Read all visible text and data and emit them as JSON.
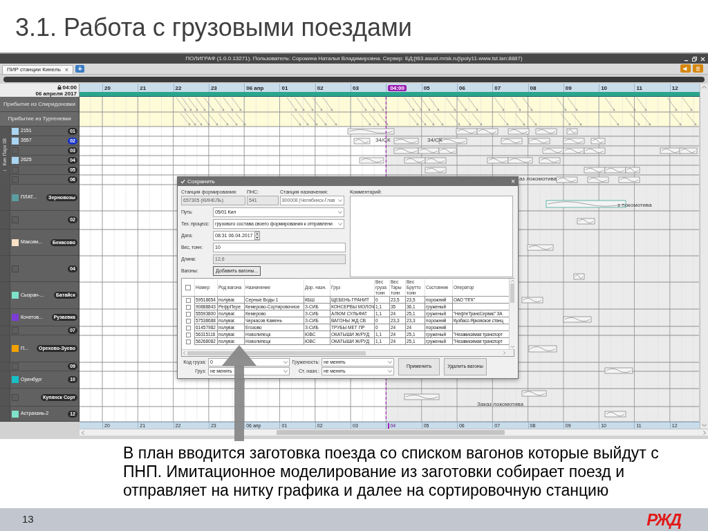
{
  "slide": {
    "title": "3.1. Работа с грузовыми поездами",
    "description": "В план вводится заготовка поезда со списком вагонов которые выйдут с ПНП. Имитационное моделирование из заготовки собирает поезд и отправляет на нитку графика и далее на сортировочную станцию",
    "page_number": "13",
    "logo": "РЖД"
  },
  "app": {
    "window": {
      "title": "ПОЛИГРАФ (1.0.0.13271). Пользователь: Сорокина Наталья Владимировна. Сервер: БД:[t63.asust.mrsk.ru]\\poly11-www.tst.lan:8887)"
    },
    "tabs": [
      {
        "label": "ПИР станции Кинель",
        "close": "×",
        "selected": true
      }
    ],
    "add_tab": "+",
    "timeline": {
      "current_time": "04:00",
      "date": "06 апреля 2017",
      "hours": [
        {
          "label": "20",
          "current": false
        },
        {
          "label": "21",
          "current": false
        },
        {
          "label": "22",
          "current": false
        },
        {
          "label": "23",
          "current": false
        },
        {
          "label": "06 апр",
          "current": false
        },
        {
          "label": "01",
          "current": false
        },
        {
          "label": "02",
          "current": false
        },
        {
          "label": "03",
          "current": false
        },
        {
          "label": "04:00",
          "current": true
        },
        {
          "label": "05",
          "current": false
        },
        {
          "label": "06",
          "current": false
        },
        {
          "label": "07",
          "current": false
        },
        {
          "label": "08",
          "current": false
        },
        {
          "label": "09",
          "current": false
        },
        {
          "label": "10",
          "current": false
        },
        {
          "label": "11",
          "current": false
        },
        {
          "label": "12",
          "current": false
        }
      ],
      "bottom_hours": [
        {
          "label": "20",
          "current": false
        },
        {
          "label": "21",
          "current": false
        },
        {
          "label": "22",
          "current": false
        },
        {
          "label": "23",
          "current": false
        },
        {
          "label": "06 апр",
          "current": false
        },
        {
          "label": "01",
          "current": false
        },
        {
          "label": "02",
          "current": false
        },
        {
          "label": "03",
          "current": false
        },
        {
          "label": "04",
          "current": true
        },
        {
          "label": "05",
          "current": false
        },
        {
          "label": "06",
          "current": false
        },
        {
          "label": "07",
          "current": false
        },
        {
          "label": "08",
          "current": false
        },
        {
          "label": "09",
          "current": false
        },
        {
          "label": "10",
          "current": false
        },
        {
          "label": "11",
          "current": false
        },
        {
          "label": "12",
          "current": false
        }
      ]
    },
    "sidebar": {
      "arrivals": [
        {
          "label": "Прибытие из Спиридоновки"
        },
        {
          "label": "Прибытие из Тургеневки"
        }
      ],
      "park": {
        "toggle": "–",
        "label": "Кин Парк 08",
        "tracks": [
          {
            "name": "2151",
            "badge": "01",
            "color": "#a9d4f2",
            "selected": false
          },
          {
            "name": "3557",
            "badge": "02",
            "color": "#a9d4f2",
            "selected": true
          },
          {
            "badge": "03",
            "selected": false
          },
          {
            "name": "2625",
            "badge": "04",
            "color": "#a9d4f2",
            "selected": false
          },
          {
            "badge": "05",
            "selected": false
          },
          {
            "badge": "06",
            "selected": false
          }
        ]
      },
      "tracks": [
        {
          "name": "ПЛАТ...",
          "badge": "Зерновозы",
          "color": "#5b9da0",
          "selected": false
        },
        {
          "badge": "02",
          "selected": false
        },
        {
          "name": "Максим...",
          "badge": "Бекасово",
          "color": "#f7e0c4",
          "selected": false
        },
        {
          "badge": "04",
          "selected": false
        },
        {
          "name": "Сызран-...",
          "badge": "Батайск",
          "color": "#7fe3c9",
          "selected": false
        },
        {
          "name": "Кочетов...",
          "badge": "Рузаевка",
          "color": "#7c3bd8",
          "selected": false
        },
        {
          "badge": "07",
          "selected": false
        },
        {
          "name": "П...",
          "badge": "Орехово-Зуево",
          "color": "#f4a100",
          "selected": false
        },
        {
          "badge": "09",
          "selected": false
        },
        {
          "name": "Оренбург",
          "badge": "10",
          "color": "#17bfc6",
          "selected": false
        },
        {
          "badge": "Купянск Сорт",
          "selected": false
        },
        {
          "name": "Астрахань-2",
          "badge": "12",
          "color": "#7fe3c9",
          "selected": false
        }
      ]
    },
    "chart": {
      "labels": [
        "34/СК",
        "34/СК",
        "аз локомотива",
        "з локомотива",
        "Заказ локомотива"
      ]
    },
    "dialog": {
      "title": "Сохранить",
      "close": "×",
      "header_fields": [
        {
          "kind": "text",
          "label": "Станция формирования:",
          "value": "657305 (КИНЕЛЬ)",
          "disabled": true
        },
        {
          "kind": "text",
          "label": "ПНС:",
          "value": "541",
          "disabled": true
        },
        {
          "kind": "select",
          "label": "Станция назначения:",
          "value": "800008 (Челябинск-Глав",
          "disabled": true
        }
      ],
      "comment": {
        "label": "Комментарий:"
      },
      "fields": [
        {
          "kind": "select",
          "label": "Путь:",
          "value": "05/01 Кил",
          "disabled": false
        },
        {
          "kind": "select",
          "label": "Тех. процесс:",
          "value": "грузового состава своего формирования к отправлени",
          "disabled": false
        },
        {
          "kind": "spinner",
          "label": "Дата:",
          "value": "08:31 06.04.2017",
          "disabled": false
        },
        {
          "kind": "text",
          "label": "Вес, тонн:",
          "value": "10",
          "disabled": false
        },
        {
          "kind": "text",
          "label": "Длина:",
          "value": "12,6",
          "disabled": true
        },
        {
          "kind": "button",
          "label": "Вагоны:",
          "value": "Добавить вагоны...",
          "disabled": false
        }
      ],
      "table": {
        "header_checked": false,
        "columns": [
          "Номер",
          "Род вагона",
          "Назначение",
          "Дор. назн.",
          "Груз",
          "Вес груза тонн",
          "Вес Тары тонн",
          "Вес Брутто тонн",
          "Состояние",
          "Оператор"
        ],
        "rows": [
          {
            "checked": false,
            "number": "59518654",
            "type": "полуваг.",
            "destination": "Серные Воды 1",
            "road": "КБШ",
            "cargo": "ЩЕБЕНЬ ГРАНИТ",
            "cargo_weight": "0",
            "tare_weight": "23,5",
            "gross_weight": "23,5",
            "state": "порожний",
            "operator": "ОАО \"ПГК\""
          },
          {
            "checked": false,
            "number": "90888843",
            "type": "РефрПере",
            "destination": "Кемерово-Сортировочное",
            "road": "З-СИБ",
            "cargo": "КОНСЕРВЫ МОЛОЧ",
            "cargo_weight": "1,1",
            "tare_weight": "35",
            "gross_weight": "36,1",
            "state": "груженый"
          },
          {
            "checked": false,
            "number": "55593800",
            "type": "полуваг.",
            "destination": "Кемерово",
            "road": "З-СИБ",
            "cargo": "АЛЮМ СУЛЬФАТ",
            "cargo_weight": "1,1",
            "tare_weight": "24",
            "gross_weight": "25,1",
            "state": "груженый",
            "operator": "\"НефтеТрансСервис\" ЗА"
          },
          {
            "checked": false,
            "number": "57538688",
            "type": "полуваг.",
            "destination": "Черкасов Камень",
            "road": "З-СИБ",
            "cargo": "ВАГОНЫ ЖД СВ",
            "cargo_weight": "0",
            "tare_weight": "23,3",
            "gross_weight": "23,3",
            "state": "порожний",
            "operator": "Кузбасс-Ярковское станц"
          },
          {
            "checked": false,
            "number": "61457982",
            "type": "полуваг.",
            "destination": "Егозово",
            "road": "З-СИБ",
            "cargo": "ТРУБЫ МЕТ ПР",
            "cargo_weight": "0",
            "tare_weight": "24",
            "gross_weight": "24",
            "state": "порожний"
          },
          {
            "checked": false,
            "number": "56315116",
            "type": "полуваг.",
            "destination": "Новолипецк",
            "road": "ЮВС",
            "cargo": "ОКАТЫШИ Ж/РУД",
            "cargo_weight": "1,1",
            "tare_weight": "24",
            "gross_weight": "25,1",
            "state": "груженый",
            "operator": "\"Независимая транспорт"
          },
          {
            "checked": false,
            "number": "56268082",
            "type": "полуваг.",
            "destination": "Новолипецк",
            "road": "ЮВС",
            "cargo": "ОКАТЫШИ Ж/РУД",
            "cargo_weight": "1,1",
            "tare_weight": "24",
            "gross_weight": "25,1",
            "state": "груженый",
            "operator": "\"Независимая транспорт"
          }
        ]
      },
      "bottom_fields": [
        {
          "kind": "select",
          "label": "Код груза:",
          "value": "0"
        },
        {
          "kind": "select",
          "label": "Груженость:",
          "value": "не менять"
        },
        {
          "kind": "select",
          "label": "Груз:",
          "value": "не менять"
        },
        {
          "kind": "select",
          "label": "Ст. назн.:",
          "value": "не менять"
        }
      ],
      "buttons": [
        "Применить",
        "Удалить вагоны"
      ]
    }
  }
}
